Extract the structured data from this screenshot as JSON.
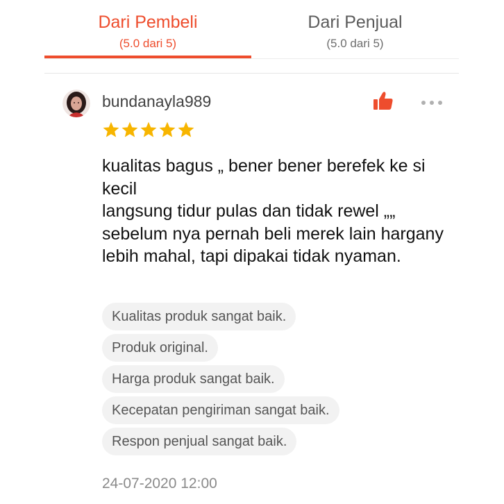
{
  "tabs": [
    {
      "label": "Dari Pembeli",
      "rating": "(5.0 dari 5)"
    },
    {
      "label": "Dari Penjual",
      "rating": "(5.0 dari 5)"
    }
  ],
  "colors": {
    "accent": "#ee4d2d",
    "star": "#f7b500",
    "tag_bg": "#f2f2f2"
  },
  "review": {
    "username": "bundanayla989",
    "rating": 5,
    "text": "kualitas bagus „ bener bener berefek ke si kecil\nlangsung tidur pulas dan tidak rewel „„\nsebelum nya pernah beli merek lain hargany lebih mahal,  tapi dipakai tidak nyaman.",
    "tags": [
      "Kualitas produk sangat baik.",
      "Produk original.",
      "Harga produk sangat baik.",
      "Kecepatan pengiriman sangat baik.",
      "Respon penjual sangat baik."
    ],
    "timestamp": "24-07-2020 12:00",
    "icons": {
      "like": "thumbs-up-icon",
      "more": "more-dots-icon",
      "avatar": "user-avatar"
    }
  }
}
